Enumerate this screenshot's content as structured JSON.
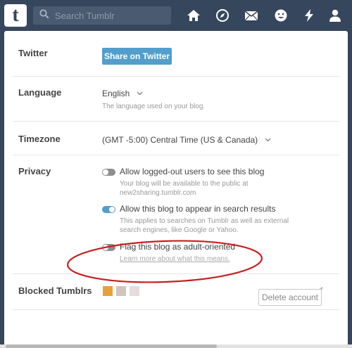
{
  "header": {
    "logo_letter": "t",
    "search_placeholder": "Search Tumblr",
    "icons": [
      "home-icon",
      "compass-icon",
      "mail-icon",
      "emoji-icon",
      "lightning-icon",
      "account-icon"
    ]
  },
  "settings": {
    "twitter": {
      "label": "Twitter",
      "button": "Share on Twitter"
    },
    "language": {
      "label": "Language",
      "value": "English",
      "hint": "The language used on your blog."
    },
    "timezone": {
      "label": "Timezone",
      "value": "(GMT -5:00) Central Time (US & Canada)"
    },
    "privacy": {
      "label": "Privacy",
      "options": [
        {
          "label": "Allow logged-out users to see this blog",
          "enabled": false,
          "hint_line1": "Your blog will be available to the public at",
          "hint_line2": "new2sharing.tumblr.com"
        },
        {
          "label": "Allow this blog to appear in search results",
          "enabled": true,
          "hint_line1": "This applies to searches on Tumblr as well as external",
          "hint_line2": "search engines, like Google or Yahoo."
        },
        {
          "label": "Flag this blog as adult-oriented",
          "enabled": false,
          "hint_link": "Learn more about what this means."
        }
      ]
    },
    "blocked": {
      "label": "Blocked Tumblrs",
      "avatar_colors": [
        "#e8a13a",
        "#cfc5bd",
        "#e6dcdc"
      ]
    },
    "delete_button": "Delete account"
  },
  "colors": {
    "navbar": "#36465d",
    "accent": "#529ecc",
    "annotation": "#c81e1e"
  }
}
